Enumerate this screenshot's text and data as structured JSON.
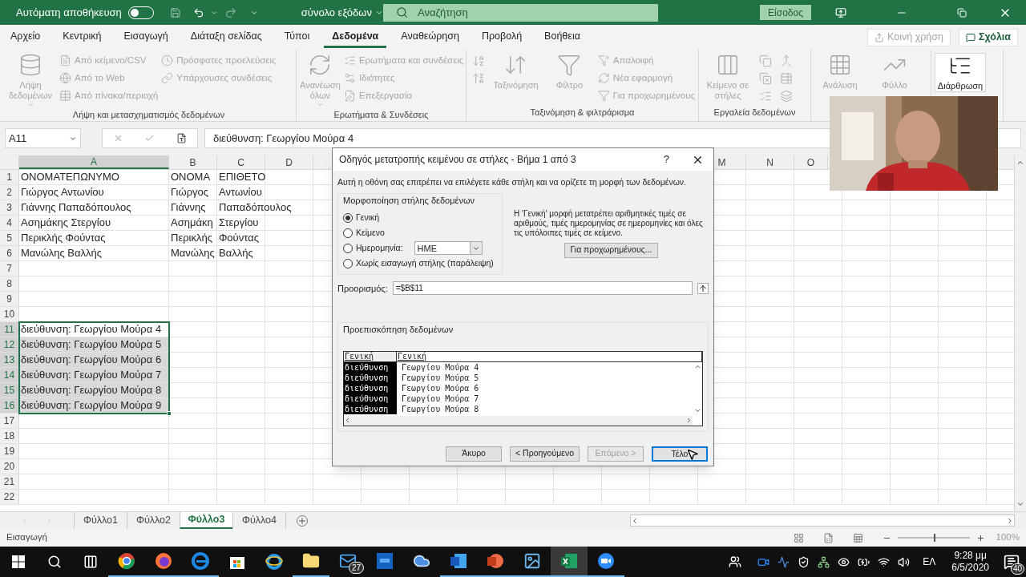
{
  "title_bar": {
    "autosave_label": "Αυτόματη αποθήκευση",
    "autosave_on": false,
    "redo_disabled": true,
    "file_name": "σύνολο εξόδων",
    "search_placeholder": "Αναζήτηση",
    "sign_in": "Είσοδος"
  },
  "tabs": [
    {
      "label": "Αρχείο",
      "selected": false
    },
    {
      "label": "Κεντρική",
      "selected": false
    },
    {
      "label": "Εισαγωγή",
      "selected": false
    },
    {
      "label": "Διάταξη σελίδας",
      "selected": false
    },
    {
      "label": "Τύποι",
      "selected": false
    },
    {
      "label": "Δεδομένα",
      "selected": true
    },
    {
      "label": "Αναθεώρηση",
      "selected": false
    },
    {
      "label": "Προβολή",
      "selected": false
    },
    {
      "label": "Βοήθεια",
      "selected": false
    }
  ],
  "share_button": {
    "label": "Κοινή χρήση",
    "disabled": true
  },
  "comments_button": {
    "label": "Σχόλια",
    "disabled": false
  },
  "ribbon": {
    "groups": [
      {
        "label": "Λήψη και μετασχηματισμός δεδομένων",
        "items": [
          {
            "kind": "large",
            "label": "Λήψη δεδομένων",
            "disabled": true,
            "menu": true
          },
          {
            "kind": "small",
            "label": "Από κείμενο/CSV",
            "disabled": true
          },
          {
            "kind": "small",
            "label": "Από το Web",
            "disabled": true
          },
          {
            "kind": "small",
            "label": "Από πίνακα/περιοχή",
            "disabled": true
          },
          {
            "kind": "small",
            "label": "Πρόσφατες προελεύσεις",
            "disabled": true
          },
          {
            "kind": "small",
            "label": "Υπάρχουσες συνδέσεις",
            "disabled": true
          }
        ]
      },
      {
        "label": "Ερωτήματα & Συνδέσεις",
        "items": [
          {
            "kind": "large",
            "label": "Ανανέωση όλων",
            "disabled": true,
            "menu": true
          },
          {
            "kind": "small",
            "label": "Ερωτήματα και συνδέσεις",
            "disabled": true
          },
          {
            "kind": "small",
            "label": "Ιδιότητες",
            "disabled": true
          },
          {
            "kind": "small",
            "label": "Επεξεργασία",
            "disabled": true
          }
        ]
      },
      {
        "label": "Ταξινόμηση & φιλτράρισμα",
        "items": [
          {
            "kind": "icon",
            "disabled": true
          },
          {
            "kind": "icon",
            "disabled": true
          },
          {
            "kind": "large",
            "label": "Ταξινόμηση",
            "disabled": true,
            "menu": false
          },
          {
            "kind": "large",
            "label": "Φίλτρο",
            "disabled": true,
            "menu": false
          },
          {
            "kind": "small",
            "label": "Απαλοιφή",
            "disabled": true
          },
          {
            "kind": "small",
            "label": "Νέα εφαρμογή",
            "disabled": true
          },
          {
            "kind": "small",
            "label": "Για προχωρημένους",
            "disabled": true
          }
        ]
      },
      {
        "label": "Εργαλεία δεδομένων",
        "items": [
          {
            "kind": "large",
            "label": "Κείμενο σε στήλες",
            "disabled": true,
            "menu": false
          },
          {
            "kind": "icon",
            "disabled": true
          },
          {
            "kind": "icon",
            "disabled": true
          },
          {
            "kind": "icon",
            "disabled": true
          },
          {
            "kind": "icon",
            "disabled": true
          },
          {
            "kind": "icon",
            "disabled": true
          },
          {
            "kind": "icon",
            "disabled": true
          }
        ]
      },
      {
        "items": [
          {
            "kind": "large",
            "label": "Ανάλυση",
            "disabled": true,
            "menu": false
          },
          {
            "kind": "large",
            "label": "Φύλλο",
            "disabled": true,
            "menu": false
          }
        ]
      },
      {
        "items": [
          {
            "kind": "large",
            "label": "Διάρθρωση",
            "disabled": false,
            "menu": false
          }
        ]
      }
    ]
  },
  "formula_bar": {
    "name_box": "A11",
    "formula": "διεύθυνση: Γεωργίου Μούρα 4"
  },
  "columns": [
    {
      "label": "A",
      "selected": true
    },
    {
      "label": "B",
      "selected": false
    },
    {
      "label": "C",
      "selected": false
    },
    {
      "label": "D",
      "selected": false
    },
    {
      "label": "M",
      "selected": false
    },
    {
      "label": "N",
      "selected": false
    },
    {
      "label": "O",
      "selected": false
    }
  ],
  "rows": [
    {
      "number": "1",
      "selected": false,
      "cells": [
        "ΟΝΟΜΑΤΕΠΩΝΥΜΟ",
        "ΟΝΟΜΑ",
        "ΕΠΙΘΕΤΟ"
      ]
    },
    {
      "number": "2",
      "selected": false,
      "cells": [
        "Γιώργος Αντωνίου",
        "Γιώργος",
        "Αντωνίου"
      ]
    },
    {
      "number": "3",
      "selected": false,
      "cells": [
        "Γιάννης Παπαδόπουλος",
        "Γιάννης",
        "Παπαδόπουλος"
      ]
    },
    {
      "number": "4",
      "selected": false,
      "cells": [
        "Ασημάκης Στεργίου",
        "Ασημάκη",
        "Στεργίου"
      ]
    },
    {
      "number": "5",
      "selected": false,
      "cells": [
        "Περικλής Φούντας",
        "Περικλής",
        "Φούντας"
      ]
    },
    {
      "number": "6",
      "selected": false,
      "cells": [
        "Μανώλης Βαλλής",
        "Μανώλης",
        "Βαλλής"
      ]
    },
    {
      "number": "7",
      "selected": false
    },
    {
      "number": "8",
      "selected": false
    },
    {
      "number": "9",
      "selected": false
    },
    {
      "number": "10",
      "selected": false
    },
    {
      "number": "11",
      "selected": true,
      "active": true,
      "cells": [
        "διεύθυνση: Γεωργίου Μούρα 4"
      ]
    },
    {
      "number": "12",
      "selected": true,
      "active": false,
      "cells": [
        "διεύθυνση: Γεωργίου Μούρα 5"
      ]
    },
    {
      "number": "13",
      "selected": true,
      "active": false,
      "cells": [
        "διεύθυνση: Γεωργίου Μούρα 6"
      ]
    },
    {
      "number": "14",
      "selected": true,
      "active": false,
      "cells": [
        "διεύθυνση: Γεωργίου Μούρα 7"
      ]
    },
    {
      "number": "15",
      "selected": true,
      "active": false,
      "cells": [
        "διεύθυνση: Γεωργίου Μούρα 8"
      ]
    },
    {
      "number": "16",
      "selected": true,
      "active": false,
      "cells": [
        "διεύθυνση: Γεωργίου Μούρα 9"
      ]
    },
    {
      "number": "17",
      "selected": false
    },
    {
      "number": "18",
      "selected": false
    },
    {
      "number": "19",
      "selected": false
    },
    {
      "number": "20",
      "selected": false
    },
    {
      "number": "21",
      "selected": false
    },
    {
      "number": "22",
      "selected": false
    }
  ],
  "dialog": {
    "title": "Οδηγός μετατροπής κειμένου σε στήλες - Βήμα 1 από 3",
    "help": "?",
    "description": "Αυτή η οθόνη σας επιτρέπει να επιλέγετε κάθε στήλη και να ορίζετε τη μορφή των δεδομένων.",
    "format_group": "Μορφοποίηση στήλης δεδομένων",
    "options": [
      {
        "kind": "radio",
        "label": "Γενική",
        "selected": true
      },
      {
        "kind": "radio",
        "label": "Κείμενο",
        "selected": false
      },
      {
        "kind": "date",
        "label": "Ημερομηνία:",
        "selected": false,
        "select": "ΗΜΕ"
      },
      {
        "kind": "radio",
        "label": "Χωρίς εισαγωγή στήλης (παράλειψη)",
        "selected": false
      }
    ],
    "info": "Η 'Γενική' μορφή μετατρέπει αριθμητικές τιμές σε αριθμούς, τιμές ημερομηνίας σε ημερομηνίες και όλες τις υπόλοιπες τιμές σε κείμενο.",
    "advanced_button": "Για προχωρημένους...",
    "destination_label": "Προορισμός:",
    "destination": "=$B$11",
    "preview_label": "Προεπισκόπηση δεδομένων",
    "preview_columns": [
      {
        "label": "Γενική",
        "selected": true
      },
      {
        "label": "Γενική",
        "selected": false
      }
    ],
    "preview_rows": [
      [
        "διεύθυνση",
        "Γεωργίου Μούρα 4"
      ],
      [
        "διεύθυνση",
        "Γεωργίου Μούρα 5"
      ],
      [
        "διεύθυνση",
        "Γεωργίου Μούρα 6"
      ],
      [
        "διεύθυνση",
        "Γεωργίου Μούρα 7"
      ],
      [
        "διεύθυνση",
        "Γεωργίου Μούρα 8"
      ]
    ],
    "buttons": [
      {
        "label": "Άκυρο",
        "disabled": false,
        "default": false
      },
      {
        "label": "< Προηγούμενο",
        "disabled": false,
        "default": false
      },
      {
        "label": "Επόμενο >",
        "disabled": true,
        "default": false
      },
      {
        "label": "Τέλο",
        "disabled": false,
        "default": true
      }
    ]
  },
  "sheets": [
    {
      "label": "Φύλλο1",
      "selected": false
    },
    {
      "label": "Φύλλο2",
      "selected": false
    },
    {
      "label": "Φύλλο3",
      "selected": true
    },
    {
      "label": "Φύλλο4",
      "selected": false
    }
  ],
  "status_bar": {
    "mode": "Εισαγωγή",
    "zoom": "100%",
    "level": 0.5
  },
  "taskbar": {
    "apps": [
      {
        "running": true,
        "active": false
      },
      {
        "running": true,
        "active": false
      },
      {
        "running": true,
        "active": false
      },
      {
        "running": false,
        "active": false
      },
      {
        "running": false,
        "active": false
      },
      {
        "running": true,
        "active": false
      },
      {
        "running": false,
        "active": false,
        "badge": "27"
      },
      {
        "running": false,
        "active": false
      },
      {
        "running": false,
        "active": false
      },
      {
        "running": true,
        "active": false
      },
      {
        "running": true,
        "active": false
      },
      {
        "running": true,
        "active": false
      },
      {
        "running": true,
        "active": true
      },
      {
        "running": true,
        "active": false
      }
    ],
    "language": "ΕΛ",
    "time": "9:28 μμ",
    "date": "6/5/2020",
    "notifications": "40"
  }
}
